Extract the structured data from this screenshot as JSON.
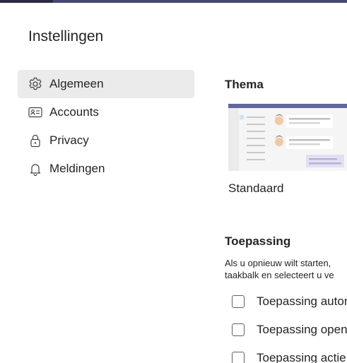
{
  "window": {
    "title": "Instellingen"
  },
  "sidebar": {
    "items": [
      {
        "label": "Algemeen",
        "icon": "gear-icon",
        "active": true
      },
      {
        "label": "Accounts",
        "icon": "account-card-icon",
        "active": false
      },
      {
        "label": "Privacy",
        "icon": "lock-icon",
        "active": false
      },
      {
        "label": "Meldingen",
        "icon": "bell-icon",
        "active": false
      }
    ]
  },
  "theme": {
    "heading": "Thema",
    "options": [
      {
        "label": "Standaard",
        "selected": true
      }
    ]
  },
  "application": {
    "heading": "Toepassing",
    "description_line1": "Als u opnieuw wilt starten,",
    "description_line2": "taakbalk en selecteert u ve",
    "checkboxes": [
      {
        "label": "Toepassing auton",
        "checked": false
      },
      {
        "label": "Toepassing open",
        "checked": false
      },
      {
        "label": "Toepassing actie",
        "checked": false
      }
    ]
  },
  "colors": {
    "accent": "#6264a7",
    "topbar": "#464775",
    "active_nav_bg": "#ebebeb",
    "text": "#242424"
  }
}
